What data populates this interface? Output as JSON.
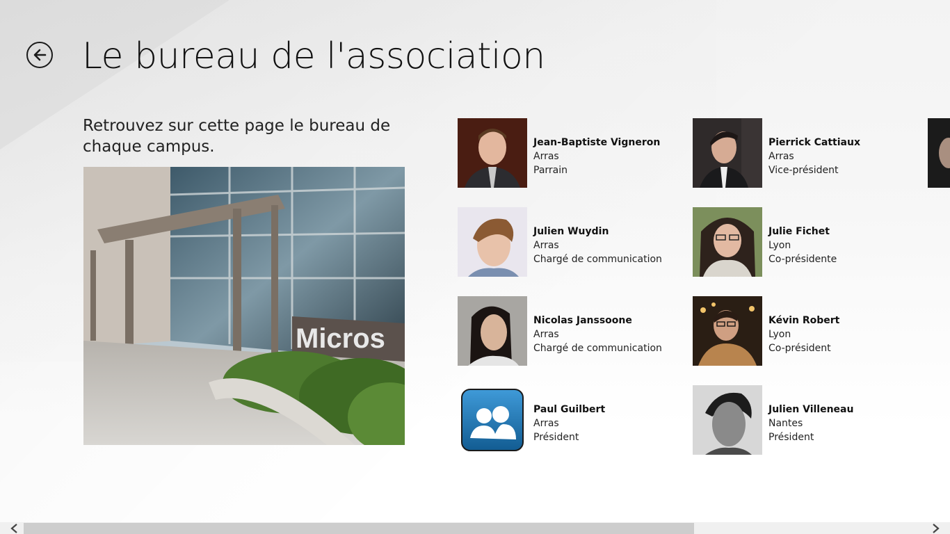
{
  "header": {
    "title": "Le bureau de l'association",
    "back_icon": "back-arrow-icon"
  },
  "intro": {
    "text": "Retrouvez sur cette page le bureau de chaque campus."
  },
  "members": [
    {
      "name": "Jean-Baptiste Vigneron",
      "campus": "Arras",
      "role": "Parrain",
      "photo": "portrait-photo"
    },
    {
      "name": "Julien Wuydin",
      "campus": "Arras",
      "role": "Chargé de communication",
      "photo": "portrait-photo"
    },
    {
      "name": "Nicolas Janssoone",
      "campus": "Arras",
      "role": "Chargé de communication",
      "photo": "portrait-photo"
    },
    {
      "name": "Paul Guilbert",
      "campus": "Arras",
      "role": "Président",
      "photo": "messenger-users-icon"
    },
    {
      "name": "Pierrick Cattiaux",
      "campus": "Arras",
      "role": "Vice-président",
      "photo": "portrait-photo"
    },
    {
      "name": "Julie Fichet",
      "campus": "Lyon",
      "role": "Co-présidente",
      "photo": "portrait-photo"
    },
    {
      "name": "Kévin Robert",
      "campus": "Lyon",
      "role": "Co-président",
      "photo": "portrait-photo"
    },
    {
      "name": "Julien Villeneau",
      "campus": "Nantes",
      "role": "Président",
      "photo": "portrait-photo"
    }
  ],
  "scrollbar": {
    "left_icon": "chevron-left-icon",
    "right_icon": "chevron-right-icon"
  },
  "colors": {
    "text": "#111111",
    "scroll_thumb": "#cdcdcd",
    "scroll_track": "#f0f0f0",
    "messenger_blue": "#1e6fae"
  }
}
